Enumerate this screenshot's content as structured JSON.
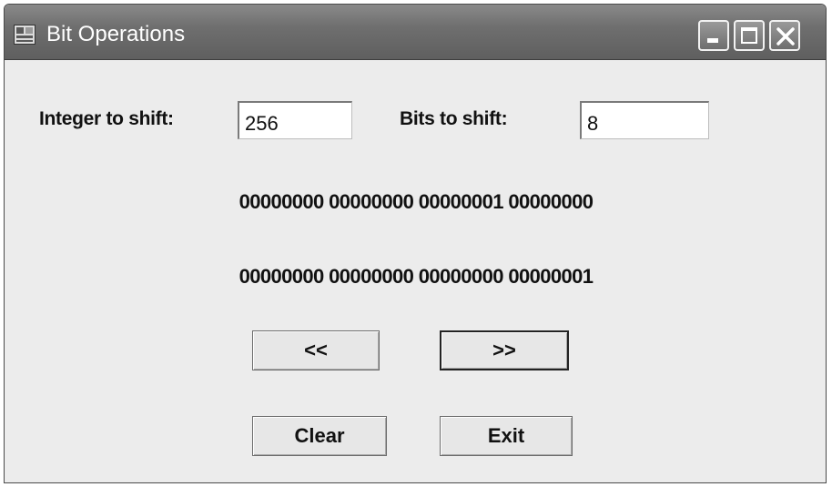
{
  "window": {
    "title": "Bit Operations"
  },
  "form": {
    "integer_label": "Integer to shift:",
    "integer_value": "256",
    "bits_label": "Bits to shift:",
    "bits_value": "8"
  },
  "output": {
    "original_bits": "00000000 00000000 00000001 00000000",
    "shifted_bits": "00000000 00000000 00000000 00000001"
  },
  "buttons": {
    "shift_left": "<<",
    "shift_right": ">>",
    "clear": "Clear",
    "exit": "Exit"
  },
  "icons": {
    "app": "app-window-icon",
    "minimize": "minimize-icon",
    "maximize": "maximize-icon",
    "close": "close-icon"
  }
}
